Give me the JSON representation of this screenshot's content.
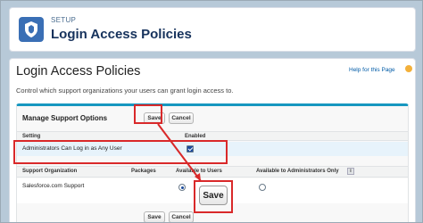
{
  "setup_header": {
    "eyebrow": "SETUP",
    "title": "Login Access Policies",
    "icon": "shield-icon"
  },
  "page": {
    "title": "Login Access Policies",
    "help_link": "Help for this Page",
    "description": "Control which support organizations your users can grant login access to."
  },
  "manage_block": {
    "title": "Manage Support Options",
    "save_label": "Save",
    "cancel_label": "Cancel",
    "settings_table": {
      "col_setting": "Setting",
      "col_enabled": "Enabled",
      "row_label": "Administrators Can Log in as Any User",
      "row_enabled": true
    },
    "org_table": {
      "col_org": "Support Organization",
      "col_packages": "Packages",
      "col_available_users": "Available to Users",
      "col_available_admins": "Available to Administrators Only",
      "info_glyph": "i",
      "row_org": "Salesforce.com Support",
      "available_users_selected": true,
      "available_admins_selected": false
    },
    "bottom_save_label": "Save",
    "bottom_cancel_label": "Cancel"
  },
  "annotation": {
    "zoom_save_label": "Save",
    "color": "#d9292a"
  }
}
